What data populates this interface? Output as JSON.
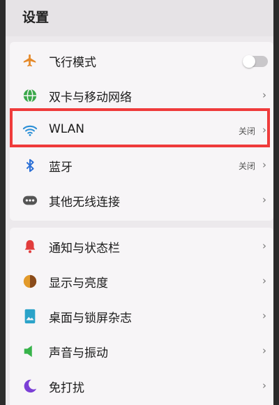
{
  "header": {
    "title": "设置"
  },
  "group1": [
    {
      "key": "airplane",
      "label": "飞行模式",
      "icon": "airplane-icon",
      "color": "#e58a2b",
      "toggle": false
    },
    {
      "key": "dual-sim",
      "label": "双卡与移动网络",
      "icon": "globe-icon",
      "color": "#3aa84a"
    },
    {
      "key": "wlan",
      "label": "WLAN",
      "status": "关闭",
      "icon": "wifi-icon",
      "color": "#2b8fd6"
    },
    {
      "key": "bluetooth",
      "label": "蓝牙",
      "status": "关闭",
      "icon": "bluetooth-icon",
      "color": "#2b6fd6"
    },
    {
      "key": "other-wireless",
      "label": "其他无线连接",
      "icon": "more-icon",
      "color": "#555555"
    }
  ],
  "group2": [
    {
      "key": "notifications",
      "label": "通知与状态栏",
      "icon": "bell-icon",
      "color": "#e23c3c"
    },
    {
      "key": "display",
      "label": "显示与亮度",
      "icon": "brightness-icon",
      "color": "#e29a2b"
    },
    {
      "key": "desktop",
      "label": "桌面与锁屏杂志",
      "icon": "desktop-icon",
      "color": "#2ba3c9"
    },
    {
      "key": "sound",
      "label": "声音与振动",
      "icon": "speaker-icon",
      "color": "#37b34a"
    },
    {
      "key": "dnd",
      "label": "免打扰",
      "icon": "moon-icon",
      "color": "#7b3fd6"
    }
  ],
  "chevron": "›"
}
